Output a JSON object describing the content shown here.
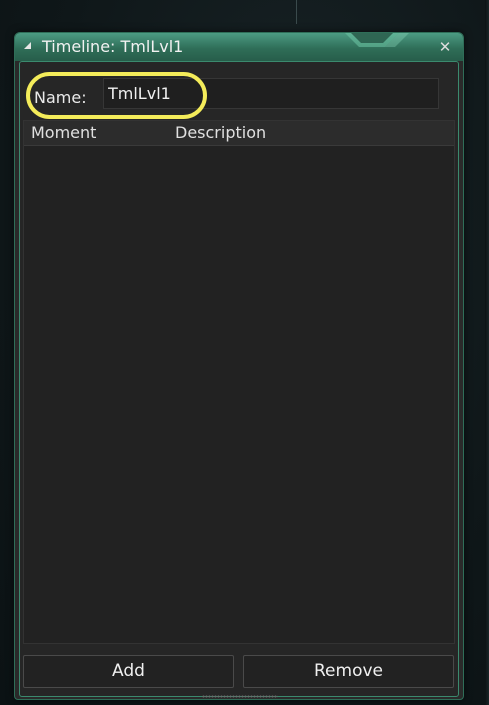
{
  "window": {
    "title": "Timeline: TmlLvl1",
    "close_glyph": "✕"
  },
  "form": {
    "name_label": "Name:",
    "name_value": "TmlLvl1"
  },
  "list": {
    "columns": [
      "Moment",
      "Description"
    ],
    "rows": []
  },
  "buttons": {
    "add_label": "Add",
    "remove_label": "Remove"
  },
  "icons": {
    "collapse": "collapse-triangle-icon",
    "close": "close-icon"
  },
  "colors": {
    "title_bar": "#2f6e58",
    "highlight": "#f4ec5a",
    "panel": "#2a2a2a"
  }
}
